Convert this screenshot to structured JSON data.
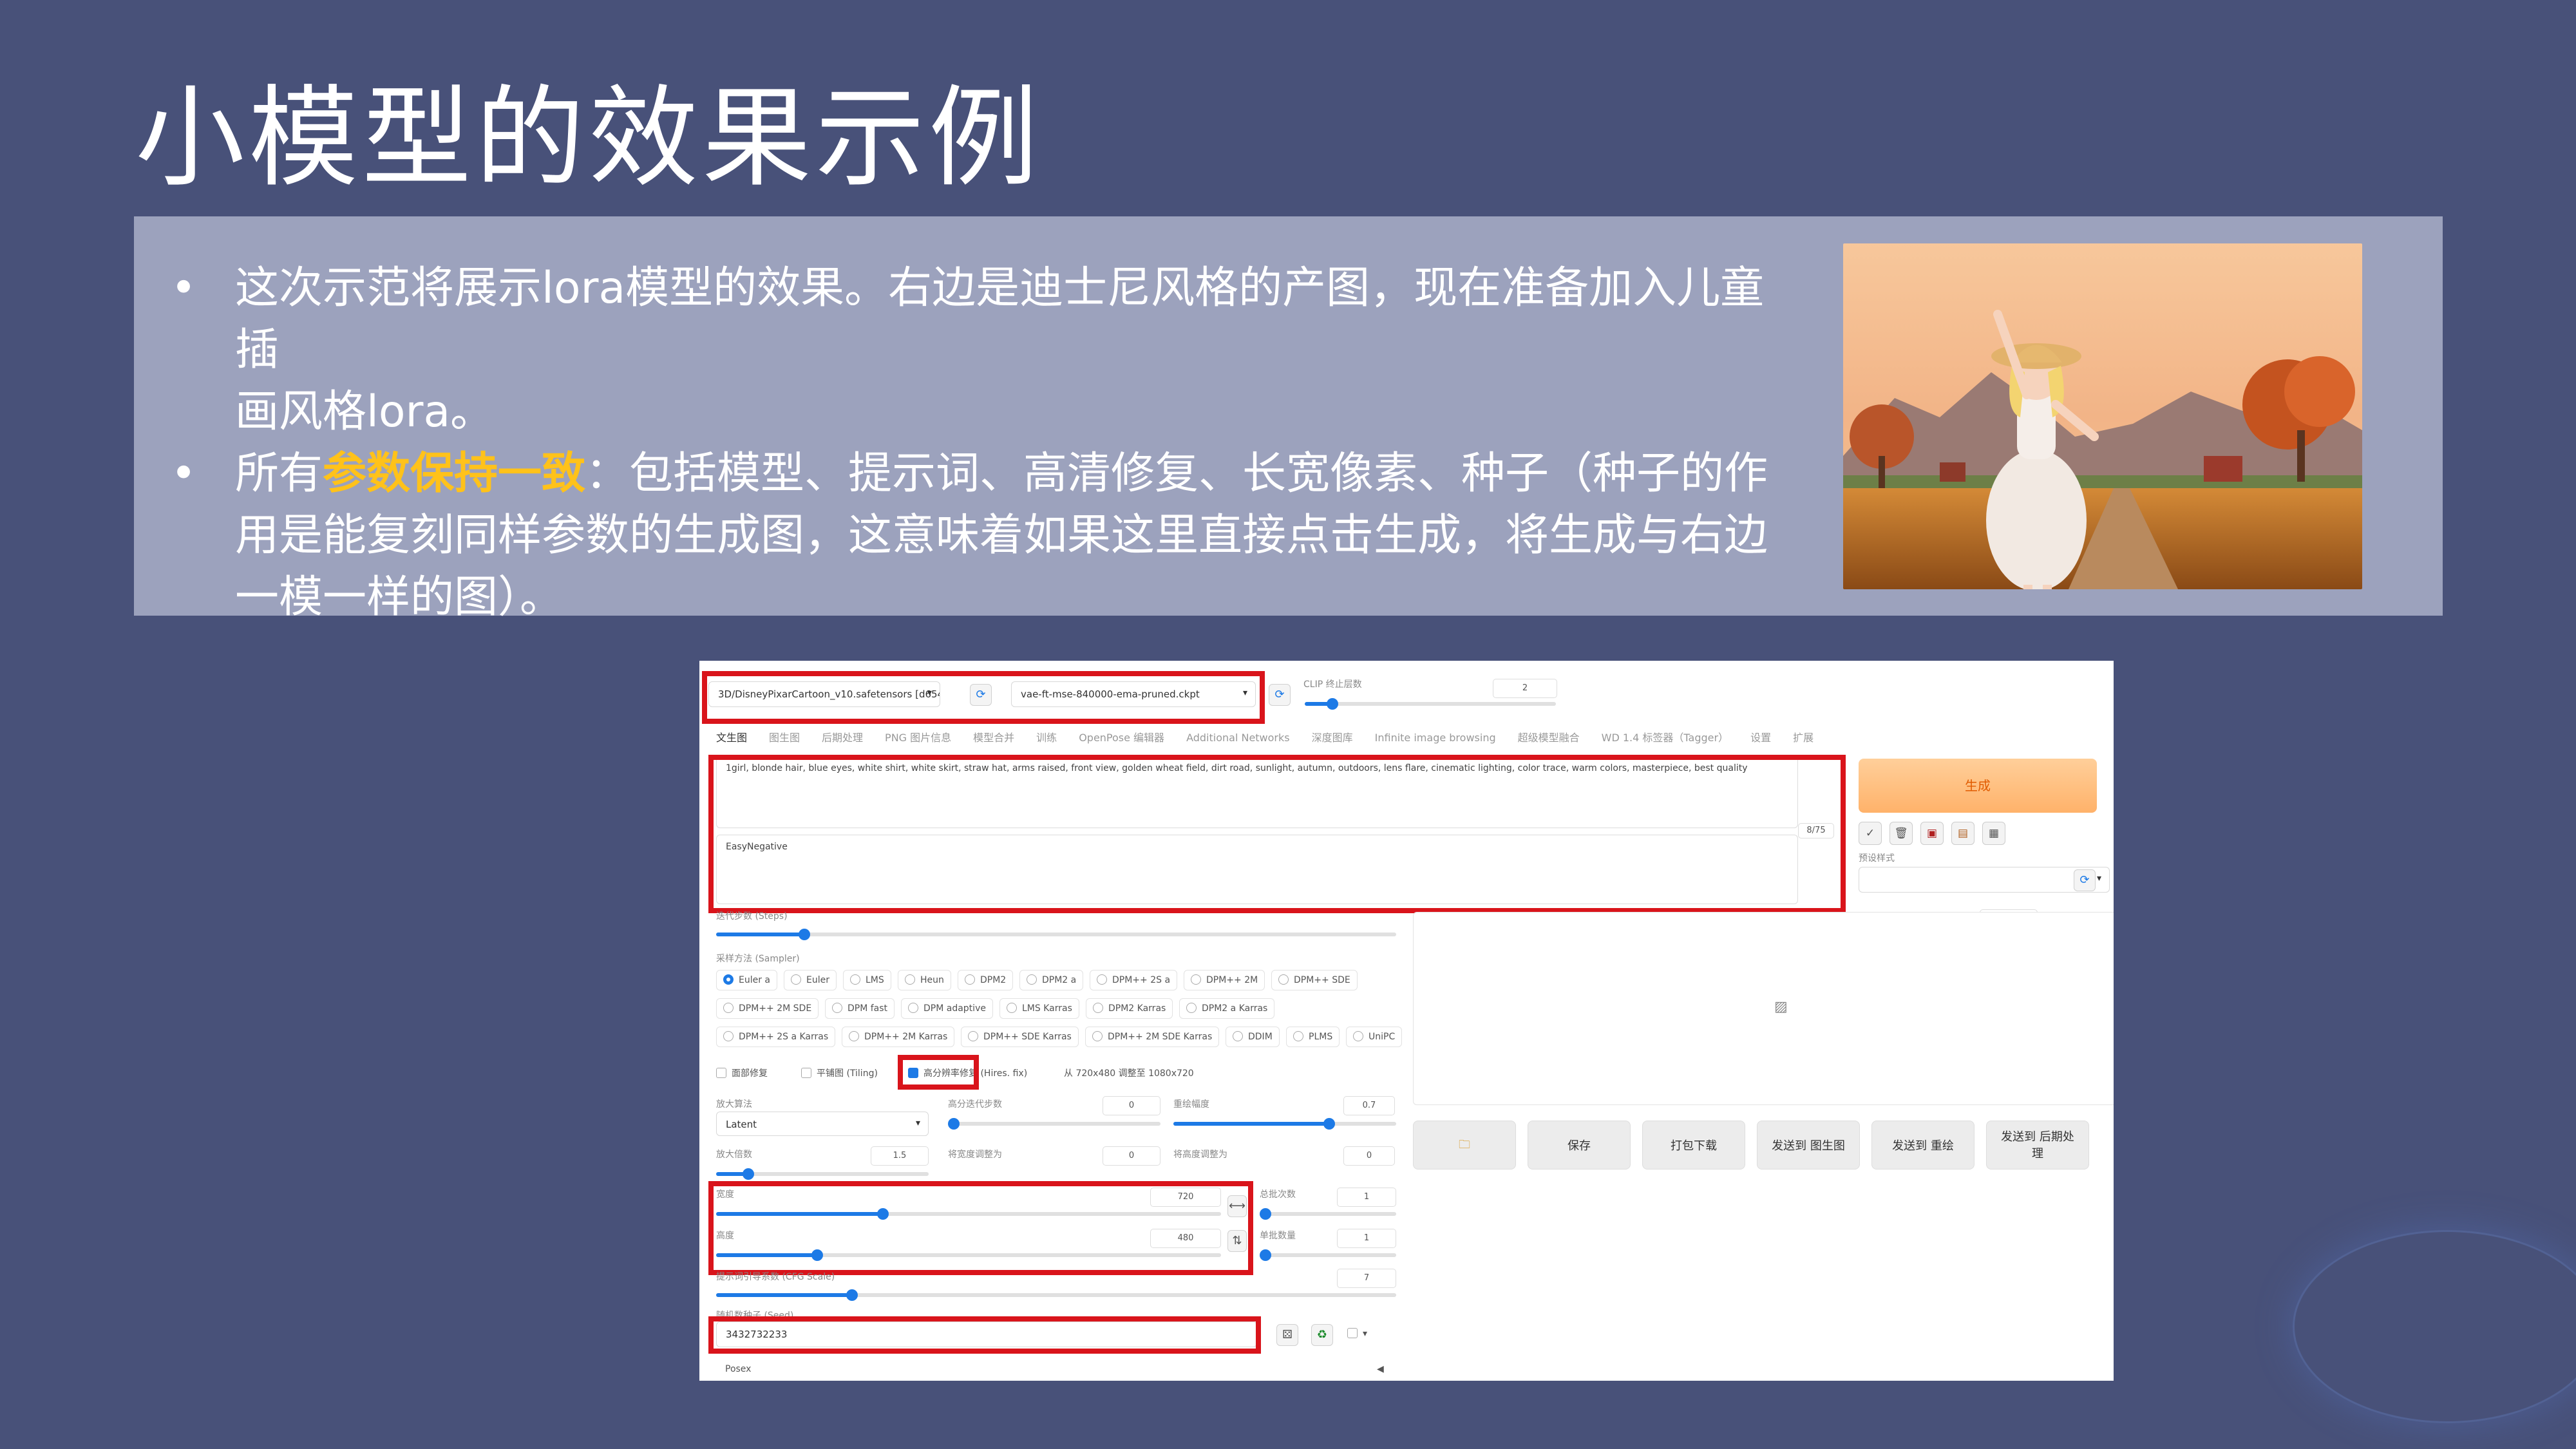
{
  "slide": {
    "title": "小模型的效果示例",
    "bullet_marker": "•",
    "bullets": [
      {
        "before": "这次示范将展示lora模型的效果。右边是迪士尼风格的产图，现在准备加入儿童插",
        "line2": "画风格lora。",
        "highlight": "",
        "after": ""
      },
      {
        "before": "所有",
        "highlight": "参数保持一致",
        "after": "：包括模型、提示词、高清修复、长宽像素、种子（种子的作",
        "line2": "用是能复刻同样参数的生成图，这意味着如果这里直接点击生成，将生成与右边",
        "line3": "一模一样的图）。"
      }
    ],
    "highlight_color": "#ffc21a",
    "background_color": "#485179",
    "band_color": "#9ca2bd",
    "highlight_box_color": "#d9141b"
  },
  "webui": {
    "model_select": "3D/DisneyPixarCartoon_v10.safetensors [d6548",
    "vae_select": "vae-ft-mse-840000-ema-pruned.ckpt",
    "clip_label": "CLIP 终止层数",
    "clip_value": "2",
    "tabs": [
      "文生图",
      "图生图",
      "后期处理",
      "PNG 图片信息",
      "模型合并",
      "训练",
      "OpenPose 编辑器",
      "Additional Networks",
      "深度图库",
      "Infinite image browsing",
      "超级模型融合",
      "WD 1.4 标签器（Tagger）",
      "设置",
      "扩展"
    ],
    "prompt": "1girl, blonde hair, blue eyes, white shirt, white skirt, straw hat, arms raised, front view, golden wheat field, dirt road, sunlight, autumn, outdoors, lens flare, cinematic lighting, color trace, warm colors, masterpiece, best quality",
    "token_count": "8/75",
    "negative_prompt": "EasyNegative",
    "generate_label": "生成",
    "tool_icons": [
      "check-icon",
      "trash-icon",
      "save-style-icon",
      "clipboard-icon",
      "style-icon"
    ],
    "tool_glyphs": [
      "✓",
      "🗑",
      "▣",
      "▤",
      "▦"
    ],
    "style_label": "预设样式",
    "style_clear": "× ▾",
    "steps_label": "迭代步数 (Steps)",
    "steps_value": "20",
    "steps_fraction": 0.13,
    "sampler_label": "采样方法 (Sampler)",
    "samplers_row1": [
      "Euler a",
      "Euler",
      "LMS",
      "Heun",
      "DPM2",
      "DPM2 a",
      "DPM++ 2S a",
      "DPM++ 2M",
      "DPM++ SDE"
    ],
    "samplers_row2": [
      "DPM++ 2M SDE",
      "DPM fast",
      "DPM adaptive",
      "LMS Karras",
      "DPM2 Karras",
      "DPM2 a Karras"
    ],
    "samplers_row3": [
      "DPM++ 2S a Karras",
      "DPM++ 2M Karras",
      "DPM++ SDE Karras",
      "DPM++ 2M SDE Karras",
      "DDIM",
      "PLMS",
      "UniPC"
    ],
    "selected_sampler": "Euler a",
    "face_fix": "面部修复",
    "tiling": "平铺图 (Tiling)",
    "hires": "高分辨率修复 (Hires. fix)",
    "hires_info": "从 720x480 调整至 1080x720",
    "upscaler_label": "放大算法",
    "upscaler_value": "Latent",
    "hires_steps_label": "高分迭代步数",
    "hires_steps_value": "0",
    "denoise_label": "重绘幅度",
    "denoise_value": "0.7",
    "denoise_fraction": 0.7,
    "upscale_by_label": "放大倍数",
    "upscale_by_value": "1.5",
    "upscale_by_fraction": 0.15,
    "resize_w_label": "将宽度调整为",
    "resize_w_value": "0",
    "resize_h_label": "将高度调整为",
    "resize_h_value": "0",
    "width_label": "宽度",
    "width_value": "720",
    "width_fraction": 0.33,
    "height_label": "高度",
    "height_value": "480",
    "height_fraction": 0.2,
    "swap_icon": "⇅",
    "batch_count_label": "总批次数",
    "batch_count_value": "1",
    "batch_size_label": "单批数量",
    "batch_size_value": "1",
    "cfg_label": "提示词引导系数 (CFG Scale)",
    "cfg_value": "7",
    "cfg_fraction": 0.2,
    "seed_label": "随机数种子 (Seed)",
    "seed_value": "3432732233",
    "posex_label": "Posex",
    "output_buttons": [
      "保存",
      "打包下载",
      "发送到 图生图",
      "发送到 重绘",
      "发送到 后期处理"
    ],
    "folder_icon": "🗀",
    "gallery_icon": "▨"
  }
}
